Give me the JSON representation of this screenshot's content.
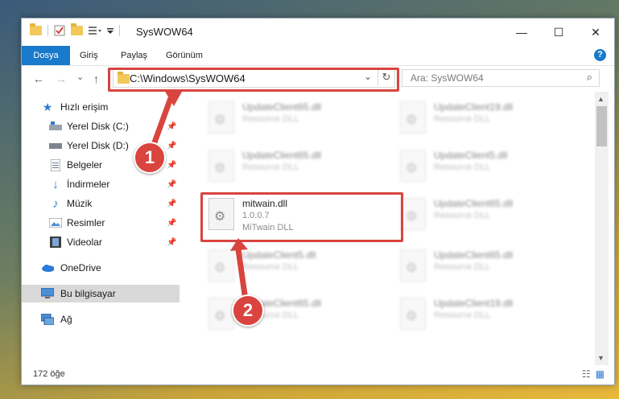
{
  "window": {
    "title": "SysWOW64",
    "controls": {
      "minimize": "—",
      "maximize": "☐",
      "close": "✕"
    }
  },
  "ribbon": {
    "tabs": [
      "Dosya",
      "Giriş",
      "Paylaş",
      "Görünüm"
    ],
    "help": "?"
  },
  "nav": {
    "back": "←",
    "forward": "→",
    "recent": "⌄",
    "up": "↑",
    "address": "C:\\Windows\\SysWOW64",
    "dropdown": "⌄",
    "refresh": "↻",
    "search_placeholder": "Ara: SysWOW64"
  },
  "sidebar": {
    "items": [
      {
        "label": "Hızlı erişim",
        "icon": "star-icon"
      },
      {
        "label": "Yerel Disk (C:)",
        "icon": "drive-icon"
      },
      {
        "label": "Yerel Disk (D:)",
        "icon": "drive-icon"
      },
      {
        "label": "Belgeler",
        "icon": "documents-icon"
      },
      {
        "label": "İndirmeler",
        "icon": "download-icon"
      },
      {
        "label": "Müzik",
        "icon": "music-icon"
      },
      {
        "label": "Resimler",
        "icon": "pictures-icon"
      },
      {
        "label": "Videolar",
        "icon": "videos-icon"
      },
      {
        "label": "OneDrive",
        "icon": "cloud-icon"
      },
      {
        "label": "Bu bilgisayar",
        "icon": "computer-icon"
      },
      {
        "label": "Ağ",
        "icon": "network-icon"
      }
    ]
  },
  "files": {
    "left": [
      {
        "name": "UpdateClient65.dll",
        "line1": "Resource DLL",
        "line2": ""
      },
      {
        "name": "UpdateClient65.dll",
        "line1": "Resource DLL",
        "line2": ""
      },
      {
        "name": "mitwain.dll",
        "line1": "1.0.0.7",
        "line2": "MiTwain DLL"
      },
      {
        "name": "UpdateClient5.dll",
        "line1": "Resource DLL",
        "line2": ""
      },
      {
        "name": "UpdateClient65.dll",
        "line1": "Resource DLL",
        "line2": ""
      }
    ],
    "right": [
      {
        "name": "UpdateClient19.dll",
        "line1": "Resource DLL"
      },
      {
        "name": "UpdateClient5.dll",
        "line1": "Resource DLL"
      },
      {
        "name": "UpdateClient65.dll",
        "line1": "Resource DLL"
      },
      {
        "name": "UpdateClient65.dll",
        "line1": "Resource DLL"
      },
      {
        "name": "UpdateClient19.dll",
        "line1": "Resource DLL"
      }
    ]
  },
  "annotations": {
    "step1": "1",
    "step2": "2"
  },
  "status": {
    "count": "172 öğe"
  }
}
